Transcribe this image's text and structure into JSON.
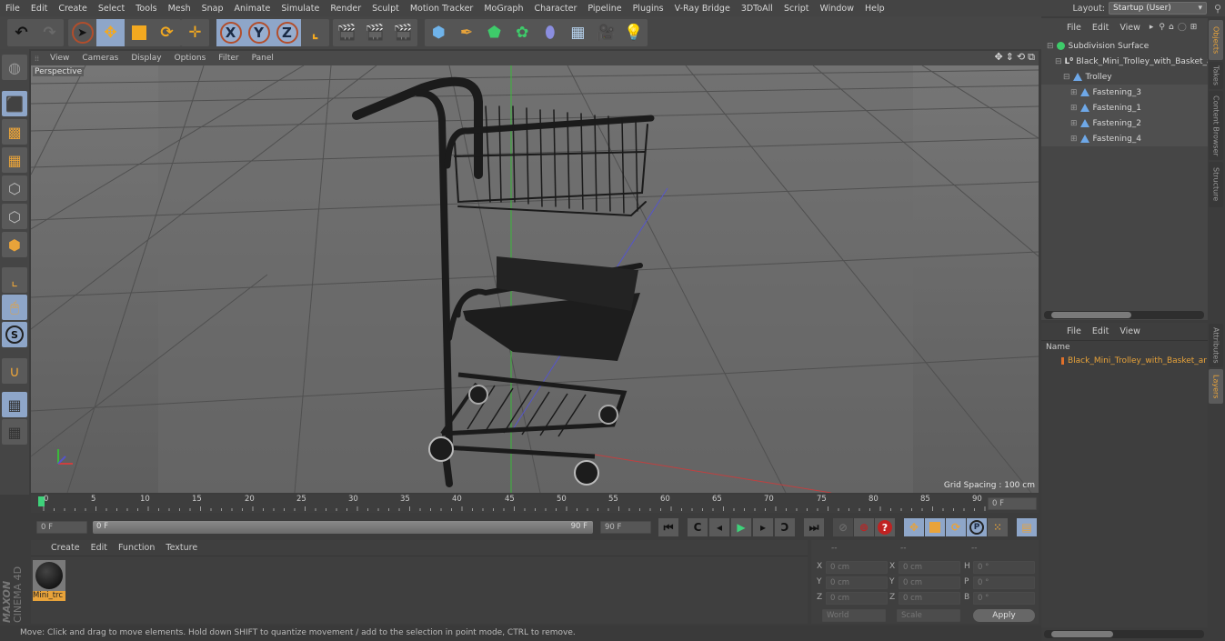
{
  "menubar": {
    "items": [
      "File",
      "Edit",
      "Create",
      "Select",
      "Tools",
      "Mesh",
      "Snap",
      "Animate",
      "Simulate",
      "Render",
      "Sculpt",
      "Motion Tracker",
      "MoGraph",
      "Character",
      "Pipeline",
      "Plugins",
      "V-Ray Bridge",
      "3DToAll",
      "Script",
      "Window",
      "Help"
    ],
    "layout_label": "Layout:",
    "layout_value": "Startup (User)"
  },
  "toolbar": {
    "undo": "undo-icon",
    "redo": "redo-icon",
    "axis_x": "X",
    "axis_y": "Y",
    "axis_z": "Z"
  },
  "viewport": {
    "menu": [
      "View",
      "Cameras",
      "Display",
      "Options",
      "Filter",
      "Panel"
    ],
    "camera_label": "Perspective",
    "grid_spacing": "Grid Spacing : 100 cm",
    "axis_x": "x",
    "axis_y": "y",
    "axis_z": "z"
  },
  "timeline": {
    "ticks": [
      "0",
      "5",
      "10",
      "15",
      "20",
      "25",
      "30",
      "35",
      "40",
      "45",
      "50",
      "55",
      "60",
      "65",
      "70",
      "75",
      "80",
      "85",
      "90"
    ],
    "current_frame": "0 F",
    "start_field": "0 F",
    "range_start": "0 F",
    "range_end": "90 F",
    "end_field": "90 F"
  },
  "material_panel": {
    "menu": [
      "Create",
      "Edit",
      "Function",
      "Texture"
    ],
    "materials": [
      {
        "name": "Mini_trc"
      }
    ]
  },
  "coordinates": {
    "headers": [
      "--",
      "--",
      "--"
    ],
    "rows": [
      {
        "a_label": "X",
        "a_val": "0 cm",
        "b_label": "X",
        "b_val": "0 cm",
        "c_label": "H",
        "c_val": "0 °"
      },
      {
        "a_label": "Y",
        "a_val": "0 cm",
        "b_label": "Y",
        "b_val": "0 cm",
        "c_label": "P",
        "c_val": "0 °"
      },
      {
        "a_label": "Z",
        "a_val": "0 cm",
        "b_label": "Z",
        "b_val": "0 cm",
        "c_label": "B",
        "c_val": "0 °"
      }
    ],
    "mode_select": "World",
    "type_select": "Scale",
    "apply_label": "Apply"
  },
  "status": {
    "text": "Move: Click and drag to move elements. Hold down SHIFT to quantize movement / add to the selection in point mode, CTRL to remove."
  },
  "brand": {
    "line1": "MAXON",
    "line2": "CINEMA 4D"
  },
  "object_manager": {
    "menu": [
      "File",
      "Edit",
      "View"
    ],
    "objects": [
      {
        "name": "Subdivision Surface",
        "icon": "subdivision-icon"
      },
      {
        "name": "Black_Mini_Trolley_with_Basket_a",
        "icon": "lod-icon"
      },
      {
        "name": "Trolley",
        "icon": "polygon-icon"
      },
      {
        "name": "Fastening_3",
        "icon": "polygon-icon"
      },
      {
        "name": "Fastening_1",
        "icon": "polygon-icon"
      },
      {
        "name": "Fastening_2",
        "icon": "polygon-icon"
      },
      {
        "name": "Fastening_4",
        "icon": "polygon-icon"
      }
    ]
  },
  "layer_manager": {
    "menu": [
      "File",
      "Edit",
      "View"
    ],
    "column_header": "Name",
    "layers": [
      {
        "name": "Black_Mini_Trolley_with_Basket_ar",
        "color": "#e0702a"
      }
    ]
  },
  "side_tabs": {
    "top": [
      "Objects",
      "Takes",
      "Content Browser",
      "Structure"
    ],
    "bottom": [
      "Attributes",
      "Layers"
    ]
  },
  "colors": {
    "accent_orange": "#e8a33a",
    "selection_blue": "#8ea6c9",
    "layer_orange": "#e0702a"
  }
}
